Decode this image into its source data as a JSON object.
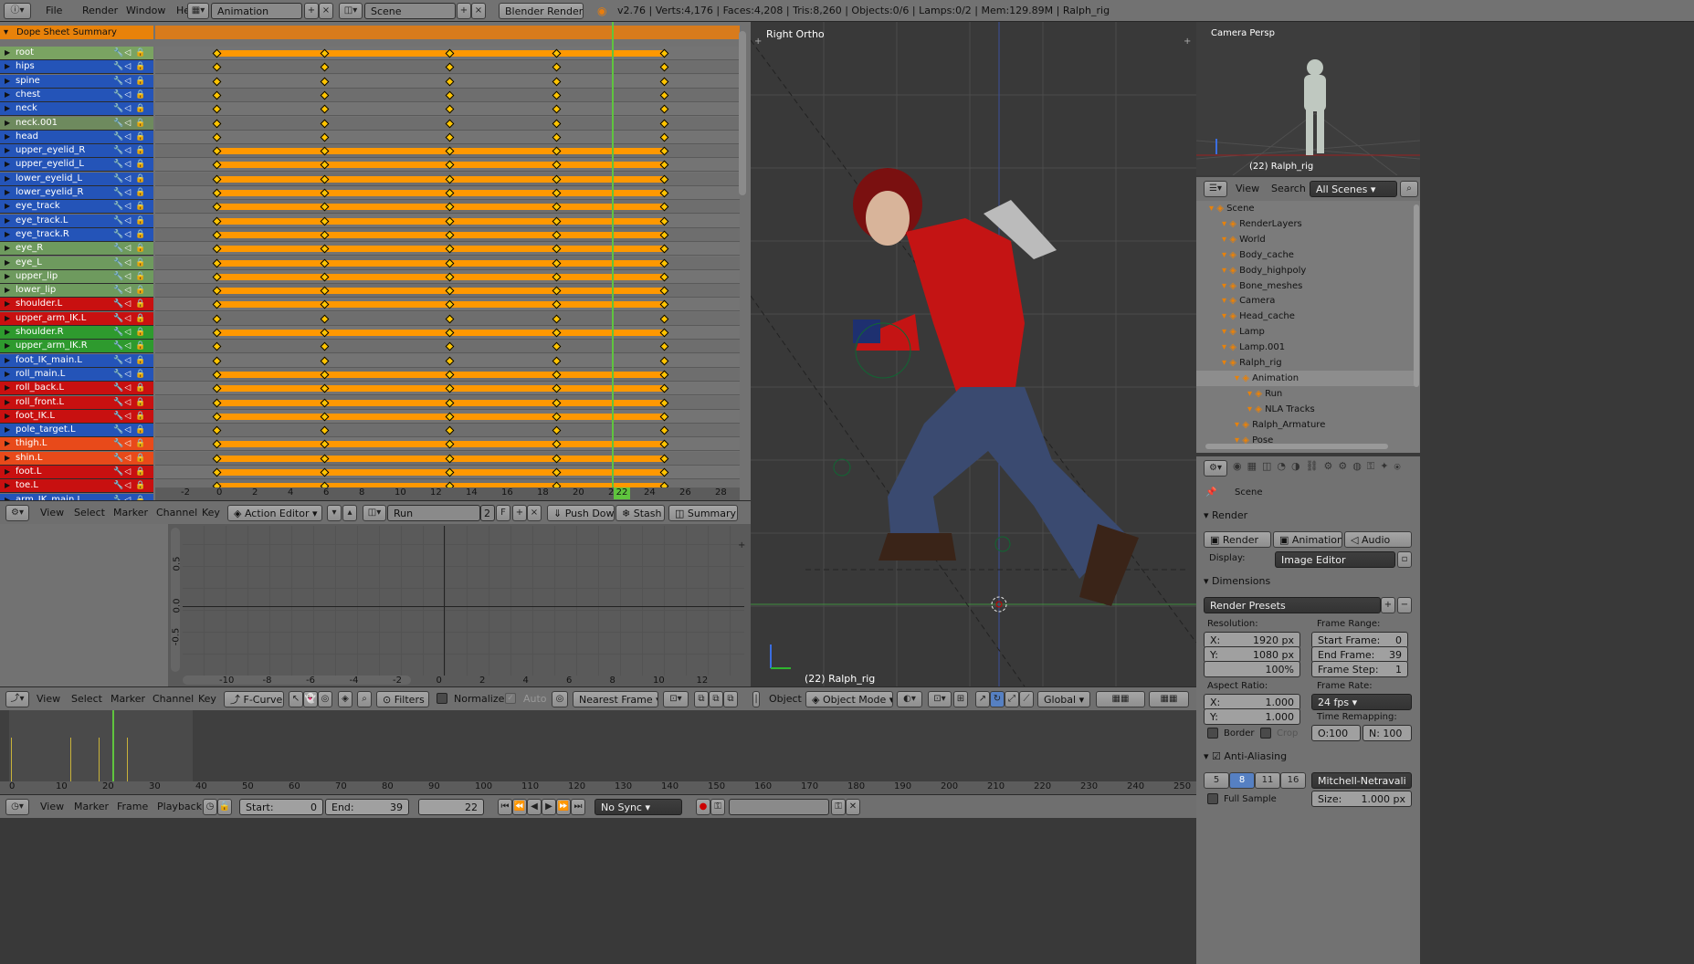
{
  "top_header": {
    "menus": [
      "File",
      "Render",
      "Window",
      "Help"
    ],
    "layout": "Animation",
    "scene": "Scene",
    "engine": "Blender Render",
    "stats": "v2.76 | Verts:4,176 | Faces:4,208 | Tris:8,260 | Objects:0/6 | Lamps:0/2 | Mem:129.89M | Ralph_rig"
  },
  "dopesheet": {
    "summary_label": "Dope Sheet Summary",
    "channels": [
      {
        "name": "root",
        "color": "#7aa362",
        "full": true
      },
      {
        "name": "hips",
        "color": "#2454b8",
        "full": false
      },
      {
        "name": "spine",
        "color": "#2454b8",
        "full": false
      },
      {
        "name": "chest",
        "color": "#2454b8",
        "full": false
      },
      {
        "name": "neck",
        "color": "#2454b8",
        "full": false
      },
      {
        "name": "neck.001",
        "color": "#6e8a5e",
        "full": false
      },
      {
        "name": "head",
        "color": "#2454b8",
        "full": false
      },
      {
        "name": "upper_eyelid_R",
        "color": "#2454b8",
        "full": true
      },
      {
        "name": "upper_eyelid_L",
        "color": "#2454b8",
        "full": true
      },
      {
        "name": "lower_eyelid_L",
        "color": "#2454b8",
        "full": true
      },
      {
        "name": "lower_eyelid_R",
        "color": "#2454b8",
        "full": true
      },
      {
        "name": "eye_track",
        "color": "#2454b8",
        "full": true
      },
      {
        "name": "eye_track.L",
        "color": "#2454b8",
        "full": true
      },
      {
        "name": "eye_track.R",
        "color": "#2454b8",
        "full": true
      },
      {
        "name": "eye_R",
        "color": "#6e9a5e",
        "full": true
      },
      {
        "name": "eye_L",
        "color": "#6e9a5e",
        "full": true
      },
      {
        "name": "upper_lip",
        "color": "#6e9a5e",
        "full": true
      },
      {
        "name": "lower_lip",
        "color": "#6e9a5e",
        "full": true
      },
      {
        "name": "shoulder.L",
        "color": "#c81010",
        "full": true
      },
      {
        "name": "upper_arm_IK.L",
        "color": "#c81010",
        "full": false
      },
      {
        "name": "shoulder.R",
        "color": "#2e9a2e",
        "full": true
      },
      {
        "name": "upper_arm_IK.R",
        "color": "#2e9a2e",
        "full": false
      },
      {
        "name": "foot_IK_main.L",
        "color": "#2454b8",
        "full": false
      },
      {
        "name": "roll_main.L",
        "color": "#2454b8",
        "full": true
      },
      {
        "name": "roll_back.L",
        "color": "#c81010",
        "full": true
      },
      {
        "name": "roll_front.L",
        "color": "#c81010",
        "full": true
      },
      {
        "name": "foot_IK.L",
        "color": "#c81010",
        "full": true
      },
      {
        "name": "pole_target.L",
        "color": "#2454b8",
        "full": false
      },
      {
        "name": "thigh.L",
        "color": "#e84a1a",
        "full": true
      },
      {
        "name": "shin.L",
        "color": "#e84a1a",
        "full": true
      },
      {
        "name": "foot.L",
        "color": "#c81010",
        "full": true
      },
      {
        "name": "toe.L",
        "color": "#c81010",
        "full": true
      },
      {
        "name": "arm_IK_main.L",
        "color": "#2454b8",
        "full": false
      }
    ],
    "keyframes": [
      0,
      6,
      13,
      19,
      25
    ],
    "current_frame": "22",
    "ruler": [
      "-2",
      "0",
      "2",
      "4",
      "6",
      "8",
      "10",
      "12",
      "14",
      "16",
      "18",
      "20",
      "22",
      "24",
      "26",
      "28"
    ],
    "header": {
      "menus": [
        "View",
        "Select",
        "Marker",
        "Channel",
        "Key"
      ],
      "mode": "Action Editor",
      "action": "Run",
      "users": "2",
      "fake": "F",
      "push_down": "Push Down",
      "stash": "Stash",
      "summary": "Summary"
    }
  },
  "graph": {
    "yticks": [
      "0.5",
      "0.0",
      "-0.5"
    ],
    "xticks": [
      "-10",
      "-8",
      "-6",
      "-4",
      "-2",
      "0",
      "2",
      "4",
      "6",
      "8",
      "10",
      "12"
    ],
    "header": {
      "menus": [
        "View",
        "Select",
        "Marker",
        "Channel",
        "Key"
      ],
      "mode": "F-Curve",
      "filters": "Filters",
      "normalize": "Normalize",
      "auto": "Auto",
      "snap": "Nearest Frame"
    }
  },
  "viewport": {
    "view_label": "Right Ortho",
    "object_label": "(22) Ralph_rig",
    "header": {
      "object_menu": "Object",
      "mode": "Object Mode",
      "orientation": "Global"
    }
  },
  "camera_view": {
    "label": "Camera Persp",
    "object_label": "(22) Ralph_rig"
  },
  "outliner": {
    "header": {
      "view": "View",
      "search": "Search",
      "filter": "All Scenes"
    },
    "items": [
      {
        "label": "Scene",
        "indent": 0
      },
      {
        "label": "RenderLayers",
        "indent": 1
      },
      {
        "label": "World",
        "indent": 1
      },
      {
        "label": "Body_cache",
        "indent": 1
      },
      {
        "label": "Body_highpoly",
        "indent": 1
      },
      {
        "label": "Bone_meshes",
        "indent": 1
      },
      {
        "label": "Camera",
        "indent": 1
      },
      {
        "label": "Head_cache",
        "indent": 1
      },
      {
        "label": "Lamp",
        "indent": 1
      },
      {
        "label": "Lamp.001",
        "indent": 1
      },
      {
        "label": "Ralph_rig",
        "indent": 1
      },
      {
        "label": "Animation",
        "indent": 2
      },
      {
        "label": "Run",
        "indent": 3
      },
      {
        "label": "NLA Tracks",
        "indent": 3
      },
      {
        "label": "Ralph_Armature",
        "indent": 2
      },
      {
        "label": "Pose",
        "indent": 2
      }
    ]
  },
  "properties": {
    "scene": "Scene",
    "render_panel": "Render",
    "render_btn": "Render",
    "animation_btn": "Animation",
    "audio_btn": "Audio",
    "display_label": "Display:",
    "display_value": "Image Editor",
    "dimensions_panel": "Dimensions",
    "presets": "Render Presets",
    "resolution_label": "Resolution:",
    "res_x": "X:",
    "res_x_val": "1920 px",
    "res_y": "Y:",
    "res_y_val": "1080 px",
    "res_pct": "100%",
    "frame_range_label": "Frame Range:",
    "start_frame": "Start Frame:",
    "start_frame_val": "0",
    "end_frame": "End Frame:",
    "end_frame_val": "39",
    "frame_step": "Frame Step:",
    "frame_step_val": "1",
    "aspect_label": "Aspect Ratio:",
    "asp_x": "X:",
    "asp_x_val": "1.000",
    "asp_y": "Y:",
    "asp_y_val": "1.000",
    "frame_rate_label": "Frame Rate:",
    "fps": "24 fps",
    "time_remap_label": "Time Remapping:",
    "old": "O:100",
    "new": "N: 100",
    "border": "Border",
    "crop": "Crop",
    "aa_panel": "Anti-Aliasing",
    "aa_samples": [
      "5",
      "8",
      "11",
      "16"
    ],
    "aa_filter": "Mitchell-Netravali",
    "full_sample": "Full Sample",
    "size_label": "Size:",
    "size_val": "1.000 px"
  },
  "timeline": {
    "ruler": [
      "0",
      "10",
      "20",
      "30",
      "40",
      "50",
      "60",
      "70",
      "80",
      "90",
      "100",
      "110",
      "120",
      "130",
      "140",
      "150",
      "160",
      "170",
      "180",
      "190",
      "200",
      "210",
      "220",
      "230",
      "240",
      "250"
    ],
    "header": {
      "menus": [
        "View",
        "Marker",
        "Frame",
        "Playback"
      ],
      "start_label": "Start:",
      "start_val": "0",
      "end_label": "End:",
      "end_val": "39",
      "current": "22",
      "sync": "No Sync"
    }
  }
}
